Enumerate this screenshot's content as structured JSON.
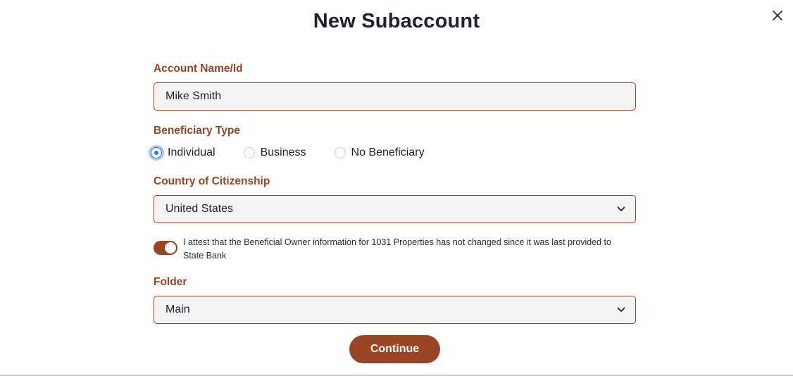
{
  "dialog": {
    "title": "New Subaccount",
    "close_icon": "close-icon"
  },
  "account_name": {
    "label": "Account Name/Id",
    "value": "Mike Smith"
  },
  "beneficiary": {
    "label": "Beneficiary Type",
    "options": [
      {
        "label": "Individual",
        "checked": true
      },
      {
        "label": "Business",
        "checked": false
      },
      {
        "label": "No Beneficiary",
        "checked": false
      }
    ]
  },
  "citizenship": {
    "label": "Country of Citizenship",
    "selected": "United States"
  },
  "attestation": {
    "enabled": true,
    "text": "I attest that the Beneficial Owner information for 1031 Properties has not changed since it was last provided to State Bank"
  },
  "folder": {
    "label": "Folder",
    "selected": "Main"
  },
  "continue_label": "Continue",
  "colors": {
    "accent": "#9a4426",
    "radio_selected": "#2f78d6",
    "field_bg": "#f5f3f4",
    "title": "#1d2130"
  }
}
